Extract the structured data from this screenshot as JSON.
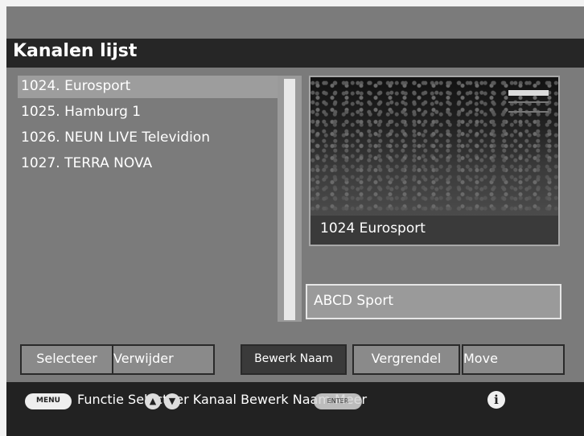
{
  "title": "Kanalen lijst",
  "channels": [
    {
      "label": "1024. Eurosport",
      "selected": true
    },
    {
      "label": "1025. Hamburg 1",
      "selected": false
    },
    {
      "label": "1026. NEUN LIVE Televidion",
      "selected": false
    },
    {
      "label": "1027. TERRA NOVA",
      "selected": false
    }
  ],
  "preview": {
    "caption": "1024 Eurosport"
  },
  "name_field": {
    "value": "ABCD Sport"
  },
  "buttons": {
    "select": "Selecteer",
    "delete": "Verwijder",
    "edit_name": "Bewerk Naam",
    "lock": "Vergrendel",
    "move": "Move"
  },
  "footer": {
    "menu_key": "MENU",
    "text": "Functie Selecteer Kanaal Bewerk Naam Meer",
    "enter_key": "ENTER",
    "icons": [
      "menu-key-icon",
      "up-arrow-icon",
      "down-arrow-icon",
      "enter-key-icon",
      "info-icon"
    ]
  },
  "colors": {
    "background": "#7b7b7b",
    "title_bar": "#262626",
    "selected_row": "#9d9d9d",
    "footer": "#222222"
  }
}
